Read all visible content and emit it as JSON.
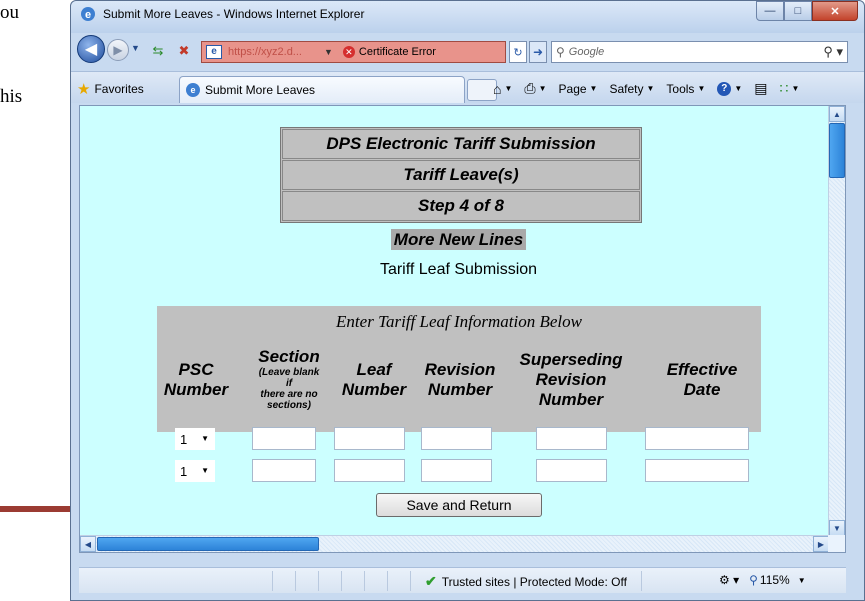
{
  "document": {
    "fragment_1": "ou",
    "fragment_2": "his"
  },
  "colors": {
    "arrow": "#9b3b32",
    "page_bg": "#ccffff",
    "table_bg": "#c0c0c0",
    "address_bar_error": "#e8938b"
  },
  "window": {
    "title": "Submit More Leaves - Windows Internet Explorer",
    "minimize_icon": "minimize-icon",
    "maximize_icon": "maximize-icon",
    "close_icon": "close-icon"
  },
  "navigation": {
    "address_url": "https://xyz2.d...",
    "certificate_error": "Certificate Error",
    "search_placeholder": "Google"
  },
  "command_bar": {
    "favorites": "Favorites",
    "tab_title": "Submit More Leaves",
    "page_menu": "Page",
    "safety_menu": "Safety",
    "tools_menu": "Tools"
  },
  "page": {
    "header_rows": [
      "DPS Electronic Tariff Submission",
      "Tariff Leave(s)",
      "Step 4 of 8"
    ],
    "more_new_lines": "More New Lines",
    "tariff_leaf_submission": "Tariff Leaf Submission",
    "form": {
      "title": "Enter Tariff Leaf Information Below",
      "columns": {
        "psc": [
          "PSC",
          "Number"
        ],
        "section": [
          "Section",
          "(Leave blank",
          "if",
          "there are no",
          "sections)"
        ],
        "leaf": [
          "Leaf",
          "Number"
        ],
        "revision": [
          "Revision",
          "Number"
        ],
        "superseding": [
          "Superseding",
          "Revision",
          "Number"
        ],
        "effective": [
          "Effective",
          "Date"
        ]
      },
      "rows": [
        {
          "psc_number": "1",
          "section": "",
          "leaf_number": "",
          "revision_number": "",
          "superseding_revision_number": "",
          "effective_date": ""
        },
        {
          "psc_number": "1",
          "section": "",
          "leaf_number": "",
          "revision_number": "",
          "superseding_revision_number": "",
          "effective_date": ""
        }
      ]
    },
    "save_button": "Save and Return"
  },
  "status_bar": {
    "zone": "Trusted sites | Protected Mode: Off",
    "zoom": "115%"
  }
}
